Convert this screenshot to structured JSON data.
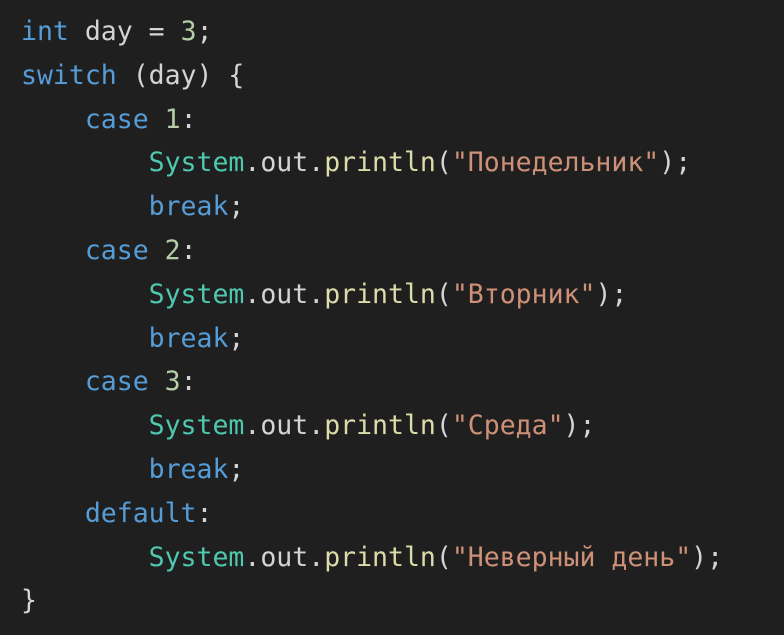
{
  "colors": {
    "background": "#1f1f1f",
    "keyword": "#569cd6",
    "identifier": "#d4d4d4",
    "number": "#b5cea8",
    "class": "#4ec9b0",
    "function": "#dcdcaa",
    "string": "#ce9178",
    "punctuation": "#d4d4d4"
  },
  "code": {
    "lines": [
      [
        {
          "t": "kw",
          "v": "int"
        },
        {
          "t": "ws",
          "v": " "
        },
        {
          "t": "id",
          "v": "day"
        },
        {
          "t": "pun",
          "v": " = "
        },
        {
          "t": "num",
          "v": "3"
        },
        {
          "t": "pun",
          "v": ";"
        }
      ],
      [
        {
          "t": "kw",
          "v": "switch"
        },
        {
          "t": "pun",
          "v": " (day) {"
        }
      ],
      [
        {
          "t": "ws",
          "v": "    "
        },
        {
          "t": "kw",
          "v": "case"
        },
        {
          "t": "ws",
          "v": " "
        },
        {
          "t": "num",
          "v": "1"
        },
        {
          "t": "pun",
          "v": ":"
        }
      ],
      [
        {
          "t": "ws",
          "v": "        "
        },
        {
          "t": "cls",
          "v": "System"
        },
        {
          "t": "pun",
          "v": "."
        },
        {
          "t": "id",
          "v": "out"
        },
        {
          "t": "pun",
          "v": "."
        },
        {
          "t": "fn",
          "v": "println"
        },
        {
          "t": "pun",
          "v": "("
        },
        {
          "t": "str",
          "v": "\"Понедельник\""
        },
        {
          "t": "pun",
          "v": ");"
        }
      ],
      [
        {
          "t": "ws",
          "v": "        "
        },
        {
          "t": "kw",
          "v": "break"
        },
        {
          "t": "pun",
          "v": ";"
        }
      ],
      [
        {
          "t": "ws",
          "v": "    "
        },
        {
          "t": "kw",
          "v": "case"
        },
        {
          "t": "ws",
          "v": " "
        },
        {
          "t": "num",
          "v": "2"
        },
        {
          "t": "pun",
          "v": ":"
        }
      ],
      [
        {
          "t": "ws",
          "v": "        "
        },
        {
          "t": "cls",
          "v": "System"
        },
        {
          "t": "pun",
          "v": "."
        },
        {
          "t": "id",
          "v": "out"
        },
        {
          "t": "pun",
          "v": "."
        },
        {
          "t": "fn",
          "v": "println"
        },
        {
          "t": "pun",
          "v": "("
        },
        {
          "t": "str",
          "v": "\"Вторник\""
        },
        {
          "t": "pun",
          "v": ");"
        }
      ],
      [
        {
          "t": "ws",
          "v": "        "
        },
        {
          "t": "kw",
          "v": "break"
        },
        {
          "t": "pun",
          "v": ";"
        }
      ],
      [
        {
          "t": "ws",
          "v": "    "
        },
        {
          "t": "kw",
          "v": "case"
        },
        {
          "t": "ws",
          "v": " "
        },
        {
          "t": "num",
          "v": "3"
        },
        {
          "t": "pun",
          "v": ":"
        }
      ],
      [
        {
          "t": "ws",
          "v": "        "
        },
        {
          "t": "cls",
          "v": "System"
        },
        {
          "t": "pun",
          "v": "."
        },
        {
          "t": "id",
          "v": "out"
        },
        {
          "t": "pun",
          "v": "."
        },
        {
          "t": "fn",
          "v": "println"
        },
        {
          "t": "pun",
          "v": "("
        },
        {
          "t": "str",
          "v": "\"Среда\""
        },
        {
          "t": "pun",
          "v": ");"
        }
      ],
      [
        {
          "t": "ws",
          "v": "        "
        },
        {
          "t": "kw",
          "v": "break"
        },
        {
          "t": "pun",
          "v": ";"
        }
      ],
      [
        {
          "t": "ws",
          "v": "    "
        },
        {
          "t": "kw",
          "v": "default"
        },
        {
          "t": "pun",
          "v": ":"
        }
      ],
      [
        {
          "t": "ws",
          "v": "        "
        },
        {
          "t": "cls",
          "v": "System"
        },
        {
          "t": "pun",
          "v": "."
        },
        {
          "t": "id",
          "v": "out"
        },
        {
          "t": "pun",
          "v": "."
        },
        {
          "t": "fn",
          "v": "println"
        },
        {
          "t": "pun",
          "v": "("
        },
        {
          "t": "str",
          "v": "\"Неверный день\""
        },
        {
          "t": "pun",
          "v": ");"
        }
      ],
      [
        {
          "t": "pun",
          "v": "}"
        }
      ]
    ]
  }
}
